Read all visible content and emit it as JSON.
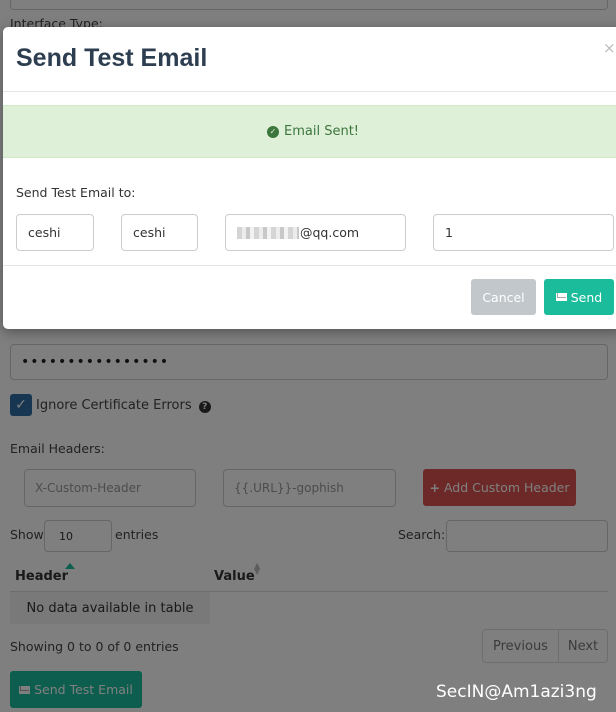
{
  "background": {
    "interface_type_label": "Interface Type:",
    "password_value": "••••••••••••••••",
    "ignore_cert_label": "Ignore Certificate Errors",
    "email_headers_label": "Email Headers:",
    "header_name_placeholder": "X-Custom-Header",
    "header_value_placeholder": "{{.URL}}-gophish",
    "add_header_label": "Add Custom Header",
    "show_label": "Show",
    "entries_value": "10",
    "entries_label": "entries",
    "search_label": "Search:",
    "table": {
      "columns": [
        "Header",
        "Value"
      ],
      "empty_text": "No data available in table"
    },
    "showing_text": "Showing 0 to 0 of 0 entries",
    "pagination": {
      "previous": "Previous",
      "next": "Next"
    },
    "send_test_email_label": "Send Test Email",
    "watermark": "SecIN@Am1azi3ng"
  },
  "modal": {
    "title": "Send Test Email",
    "close": "×",
    "alert_text": "Email Sent!",
    "send_to_label": "Send Test Email to:",
    "first_name_value": "ceshi",
    "last_name_value": "ceshi",
    "email_value_suffix": "@qq.com",
    "position_value": "1",
    "cancel_label": "Cancel",
    "send_label": "Send"
  },
  "colors": {
    "primary": "#1abc9c",
    "danger": "#d9534f",
    "success_bg": "#dff0d8",
    "success_text": "#3c763d",
    "title": "#2c3e50"
  }
}
